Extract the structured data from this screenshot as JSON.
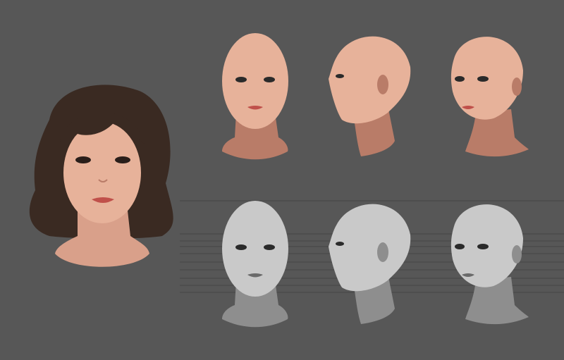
{
  "artwork": {
    "background_color": "#575757",
    "skin_color": "#e7b29a",
    "skin_shadow_color": "#b97c68",
    "hair_color": "#3a2a22",
    "gray_color": "#c9c9c9",
    "gray_shadow_color": "#8e8e8e",
    "guide_line_color": "#454545",
    "lip_color": "#c0504a"
  }
}
